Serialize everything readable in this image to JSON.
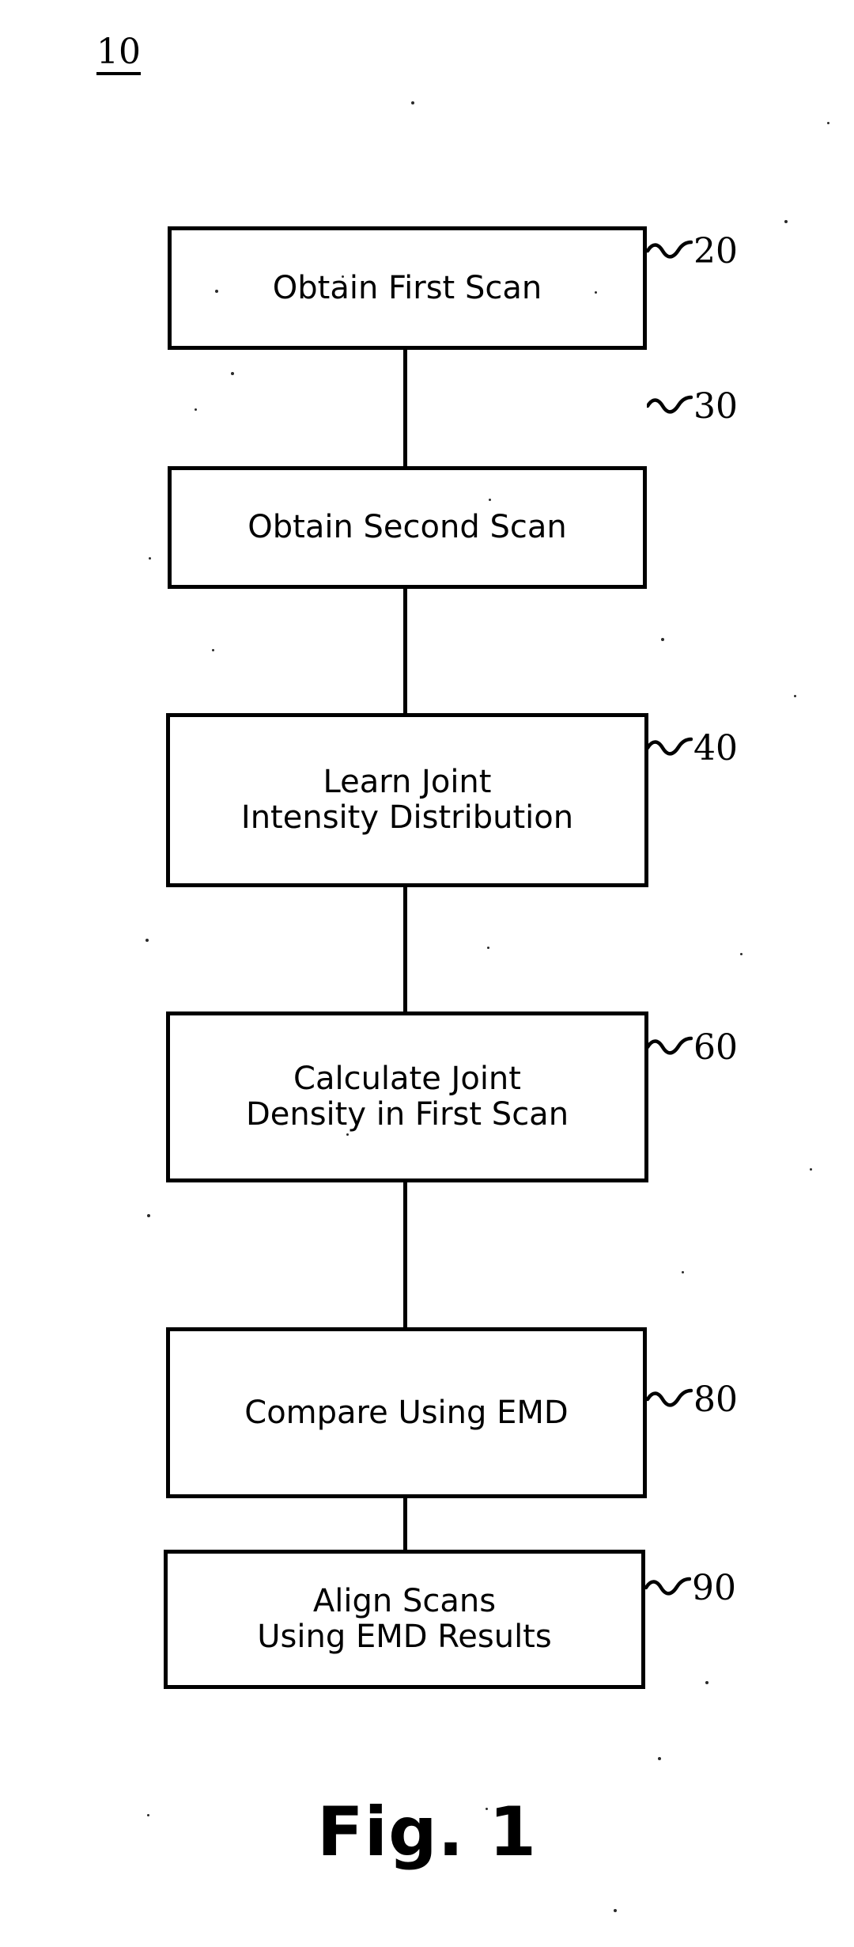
{
  "figure": {
    "reference_number": "10",
    "caption": "Fig. 1"
  },
  "flowchart": {
    "nodes": [
      {
        "label": "Obtain First Scan",
        "ref": "20"
      },
      {
        "label": "Obtain Second Scan",
        "ref": "30"
      },
      {
        "label": "Learn Joint\nIntensity Distribution",
        "ref": "40"
      },
      {
        "label": "Calculate Joint\nDensity in First Scan",
        "ref": "60"
      },
      {
        "label": "Compare Using EMD",
        "ref": "80"
      },
      {
        "label": "Align Scans\nUsing EMD Results",
        "ref": "90"
      }
    ]
  },
  "colors": {
    "ink": "#000000",
    "paper": "#ffffff"
  }
}
